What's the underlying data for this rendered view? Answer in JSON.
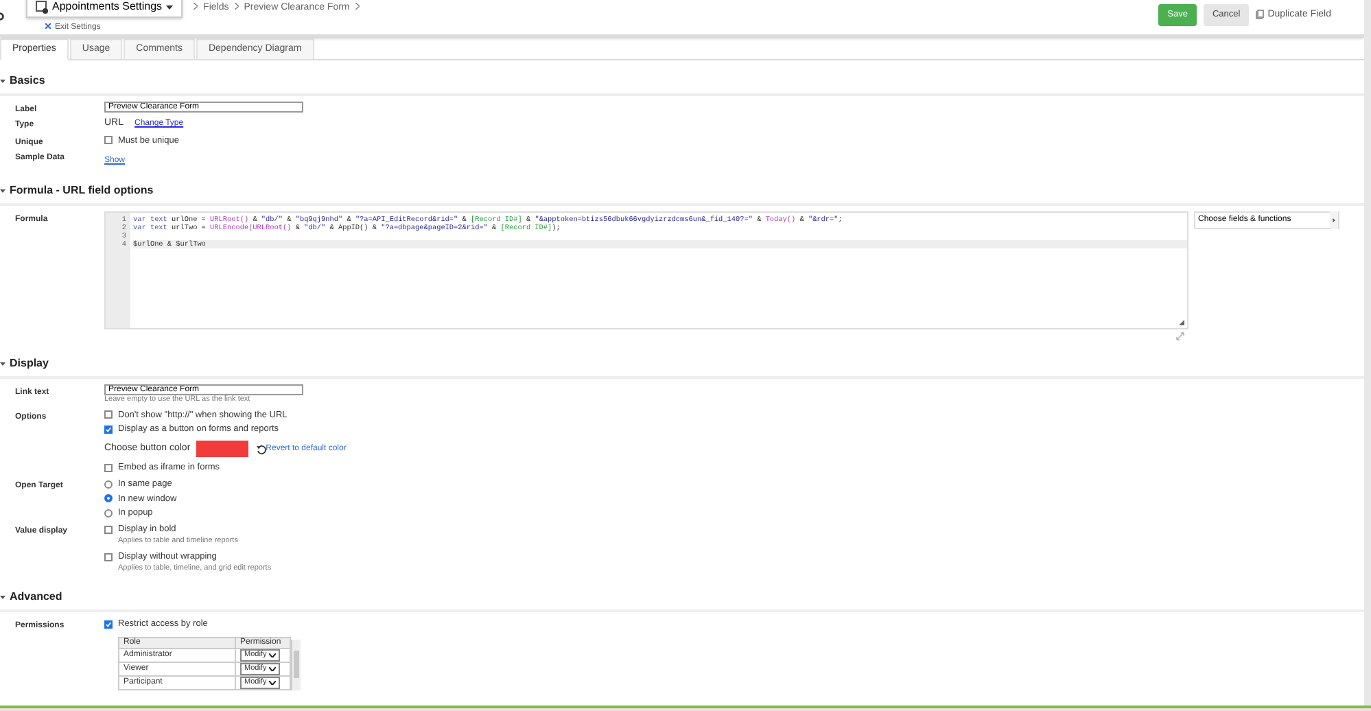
{
  "header": {
    "app_menu": "Appointments Settings",
    "exit_link": "Exit Settings",
    "breadcrumbs": [
      "Fields",
      "Preview Clearance Form"
    ],
    "buttons": [
      {
        "label": "Save",
        "kind": "primary"
      },
      {
        "label": "Cancel",
        "kind": "secondary"
      },
      {
        "label": "Duplicate Field",
        "kind": "link"
      }
    ]
  },
  "tabs": [
    {
      "label": "Properties",
      "selected": true
    },
    {
      "label": "Usage",
      "selected": false
    },
    {
      "label": "Comments",
      "selected": false
    },
    {
      "label": "Dependency Diagram",
      "selected": false
    }
  ],
  "sections": [
    {
      "title": "Basics",
      "expanded": true,
      "rows": [
        {
          "label": "Label",
          "controls": [
            {
              "kind": "text_input",
              "value": "Preview Clearance Form"
            }
          ]
        },
        {
          "label": "Type",
          "controls": [
            {
              "kind": "value_link",
              "value": "URL",
              "link": "Change Type"
            }
          ]
        },
        {
          "label": "Unique",
          "controls": [
            {
              "kind": "checkbox",
              "label": "Must be unique",
              "checked": false
            }
          ]
        },
        {
          "label": "Sample Data",
          "controls": [
            {
              "kind": "link",
              "label": "Show"
            }
          ]
        }
      ]
    },
    {
      "title": "Formula - URL field options",
      "expanded": true,
      "rows": [
        {
          "label": "Formula",
          "controls": [
            {
              "kind": "formula",
              "picker": "Choose fields & functions",
              "lines": [
                {
                  "number": "1",
                  "highlighted": false,
                  "tokens": [
                    {
                      "kind": "keyword",
                      "text": "var text"
                    },
                    {
                      "kind": "plain",
                      "text": " urlOne = "
                    },
                    {
                      "kind": "function",
                      "text": "URLRoot()"
                    },
                    {
                      "kind": "plain",
                      "text": " & "
                    },
                    {
                      "kind": "string",
                      "text": "\"db/\""
                    },
                    {
                      "kind": "plain",
                      "text": " & "
                    },
                    {
                      "kind": "string",
                      "text": "\"bq9qj9nhd\""
                    },
                    {
                      "kind": "plain",
                      "text": " & "
                    },
                    {
                      "kind": "string",
                      "text": "\"?a=API_EditRecord&rid=\""
                    },
                    {
                      "kind": "plain",
                      "text": " & "
                    },
                    {
                      "kind": "field",
                      "text": "[Record ID#]"
                    },
                    {
                      "kind": "plain",
                      "text": " & "
                    },
                    {
                      "kind": "string",
                      "text": "\"&apptoken=btizs56dbuk66vgdyizrzdcms6un&_fid_140?=\""
                    },
                    {
                      "kind": "plain",
                      "text": " & "
                    },
                    {
                      "kind": "function",
                      "text": "Today()"
                    },
                    {
                      "kind": "plain",
                      "text": " & "
                    },
                    {
                      "kind": "string",
                      "text": "\"&rdr=\""
                    },
                    {
                      "kind": "plain",
                      "text": ";"
                    }
                  ]
                },
                {
                  "number": "2",
                  "highlighted": false,
                  "tokens": [
                    {
                      "kind": "keyword",
                      "text": "var text"
                    },
                    {
                      "kind": "plain",
                      "text": " urlTwo = "
                    },
                    {
                      "kind": "function",
                      "text": "URLEncode(URLRoot()"
                    },
                    {
                      "kind": "plain",
                      "text": " & "
                    },
                    {
                      "kind": "string",
                      "text": "\"db/\""
                    },
                    {
                      "kind": "plain",
                      "text": " & AppID() & "
                    },
                    {
                      "kind": "string",
                      "text": "\"?a=dbpage&pageID=2&rid=\""
                    },
                    {
                      "kind": "plain",
                      "text": " & "
                    },
                    {
                      "kind": "field",
                      "text": "[Record ID#]"
                    },
                    {
                      "kind": "plain",
                      "text": ");"
                    }
                  ]
                },
                {
                  "number": "3",
                  "highlighted": false
                },
                {
                  "number": "4",
                  "highlighted": true,
                  "tokens": [
                    {
                      "kind": "plain",
                      "text": "$urlOne & $urlTwo"
                    }
                  ]
                }
              ]
            }
          ]
        }
      ]
    },
    {
      "title": "Display",
      "expanded": true,
      "rows": [
        {
          "label": "Link text",
          "controls": [
            {
              "kind": "text_input",
              "value": "Preview Clearance Form",
              "hint": "Leave empty to use the URL as the link text"
            }
          ]
        },
        {
          "label": "Options",
          "controls": [
            {
              "kind": "checkbox",
              "label": "Don't show \"http://\" when showing the URL",
              "checked": false
            },
            {
              "kind": "checkbox",
              "label": "Display as a button on forms and reports",
              "checked": true
            },
            {
              "kind": "color",
              "label": "Choose button color",
              "color": "#f23c3c",
              "link": "Revert to default color"
            },
            {
              "kind": "checkbox",
              "label": "Embed as iframe in forms",
              "checked": false
            }
          ]
        },
        {
          "label": "Open Target",
          "controls": [
            {
              "kind": "radio",
              "label": "In same page",
              "selected": false
            },
            {
              "kind": "radio",
              "label": "In new window",
              "selected": true
            },
            {
              "kind": "radio",
              "label": "In popup",
              "selected": false
            }
          ]
        },
        {
          "label": "Value display",
          "controls": [
            {
              "kind": "checkbox",
              "label": "Display in bold",
              "checked": false,
              "hint": "Applies to table and timeline reports"
            },
            {
              "kind": "checkbox",
              "label": "Display without wrapping",
              "checked": false,
              "hint": "Applies to table, timeline, and grid edit reports"
            }
          ]
        }
      ]
    },
    {
      "title": "Advanced",
      "expanded": true,
      "rows": [
        {
          "label": "Permissions",
          "controls": [
            {
              "kind": "checkbox",
              "label": "Restrict access by role",
              "checked": true
            },
            {
              "kind": "role_table",
              "columns": [
                "Role",
                "Permission"
              ],
              "rows": [
                {
                  "role": "Administrator",
                  "permission": "Modify"
                },
                {
                  "role": "Viewer",
                  "permission": "Modify"
                },
                {
                  "role": "Participant",
                  "permission": "Modify"
                }
              ]
            }
          ]
        }
      ]
    }
  ]
}
